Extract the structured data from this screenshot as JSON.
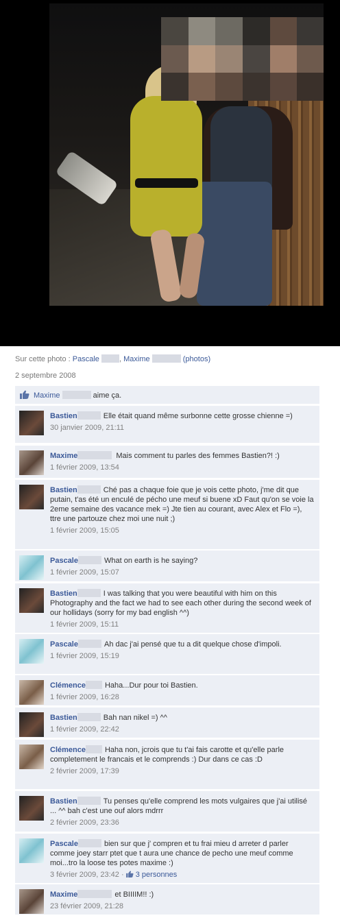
{
  "colors": {
    "link": "#3b5998",
    "comment_bg": "#eceff5",
    "meta": "#777777"
  },
  "tags": {
    "prefix": "Sur cette photo : ",
    "name1": "Pascale",
    "name2": "Maxime",
    "sep": ",",
    "photos": "(photos)"
  },
  "date": "2 septembre 2008",
  "likes": {
    "icon": "thumbs-up-icon",
    "name": "Maxime",
    "text": "aime ça."
  },
  "comments": [
    {
      "name": "Bastien",
      "text": "Elle était quand même surbonne cette grosse chienne =)",
      "time": "30 janvier 2009, 21:11"
    },
    {
      "name": "Maxime",
      "text": "Mais comment tu parles des femmes Bastien?! :)",
      "time": "1 février 2009, 13:54"
    },
    {
      "name": "Bastien",
      "text": "Ché pas a chaque foie que je vois cette photo, j'me dit que putain, t'as été un enculé de pécho une meuf si buene xD Faut qu'on se voie la 2eme semaine des vacance mek =) Jte tien au courant, avec Alex et Flo =), ttre une partouze chez moi une nuit ;)",
      "time": "1 février 2009, 15:05"
    },
    {
      "name": "Pascale",
      "text": "What on earth is he saying?",
      "time": "1 février 2009, 15:07"
    },
    {
      "name": "Bastien",
      "text": "I was talking that you were beautiful with him on this Photography and the fact we had to see each other during the second week of our hollidays (sorry for my bad english ^^)",
      "time": "1 février 2009, 15:11"
    },
    {
      "name": "Pascale",
      "text": "Ah dac j'ai pensé que tu a dit quelque chose d'impoli.",
      "time": "1 février 2009, 15:19"
    },
    {
      "name": "Clémence",
      "text": "Haha...Dur pour toi Bastien.",
      "time": "1 février 2009, 16:28"
    },
    {
      "name": "Bastien",
      "text": "Bah nan nikel =) ^^",
      "time": "1 février 2009, 22:42"
    },
    {
      "name": "Clémence",
      "text": "Haha non, jcrois que tu t'ai fais carotte et qu'elle parle completement le francais et le comprends :) Dur dans ce cas :D",
      "time": "2 février 2009, 17:39"
    },
    {
      "name": "Bastien",
      "text": "Tu penses qu'elle comprend les mots vulgaires que j'ai utilisé ... ^^ bah c'est une ouf alors mdrrr",
      "time": "2 février 2009, 23:36"
    },
    {
      "name": "Pascale",
      "text": "bien sur que j' compren et tu frai mieu d arreter d parler comme joey starr ptet que t aura une chance de pecho une meuf comme moi...tro la loose tes potes maxime :)",
      "time": "3 février 2009, 23:42",
      "like_sep": " · ",
      "like_count": "3 personnes"
    },
    {
      "name": "Maxime",
      "text": "et BIIIIM!! :)",
      "time": "23 février 2009, 21:28"
    }
  ]
}
